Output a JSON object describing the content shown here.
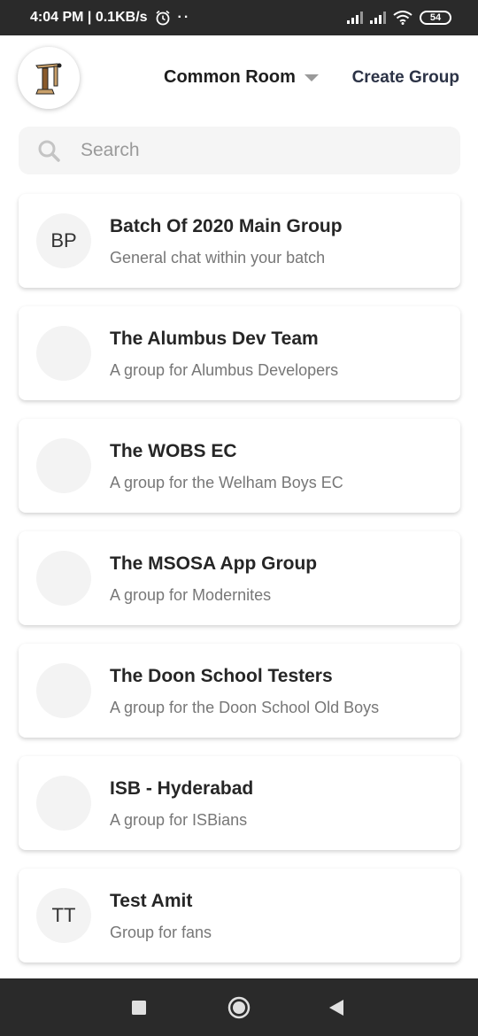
{
  "status_bar": {
    "time_speed": "4:04 PM | 0.1KB/s",
    "battery": "54"
  },
  "header": {
    "room_label": "Common Room",
    "create_group_label": "Create Group"
  },
  "search": {
    "placeholder": "Search"
  },
  "groups": [
    {
      "initials": "BP",
      "title": "Batch Of 2020 Main Group",
      "subtitle": "General chat within your batch"
    },
    {
      "initials": "",
      "title": "The Alumbus Dev Team",
      "subtitle": "A group for Alumbus Developers"
    },
    {
      "initials": "",
      "title": "The WOBS EC",
      "subtitle": "A group for the Welham Boys EC"
    },
    {
      "initials": "",
      "title": "The MSOSA App Group",
      "subtitle": "A group for Modernites"
    },
    {
      "initials": "",
      "title": "The Doon School Testers",
      "subtitle": "A group for the Doon School Old Boys"
    },
    {
      "initials": "",
      "title": "ISB - Hyderabad",
      "subtitle": "A group for ISBians"
    },
    {
      "initials": "TT",
      "title": "Test Amit",
      "subtitle": "Group for fans"
    }
  ],
  "colors": {
    "status_bar_bg": "#2a2a2a",
    "accent_text": "#2c3346",
    "search_bg": "#f5f5f5",
    "avatar_bg": "#f3f3f3"
  },
  "icons": {
    "status": [
      "alarm-icon",
      "signal-icon",
      "wifi-icon",
      "battery-icon"
    ],
    "nav": [
      "recents-square-icon",
      "home-circle-icon",
      "back-triangle-icon"
    ]
  }
}
